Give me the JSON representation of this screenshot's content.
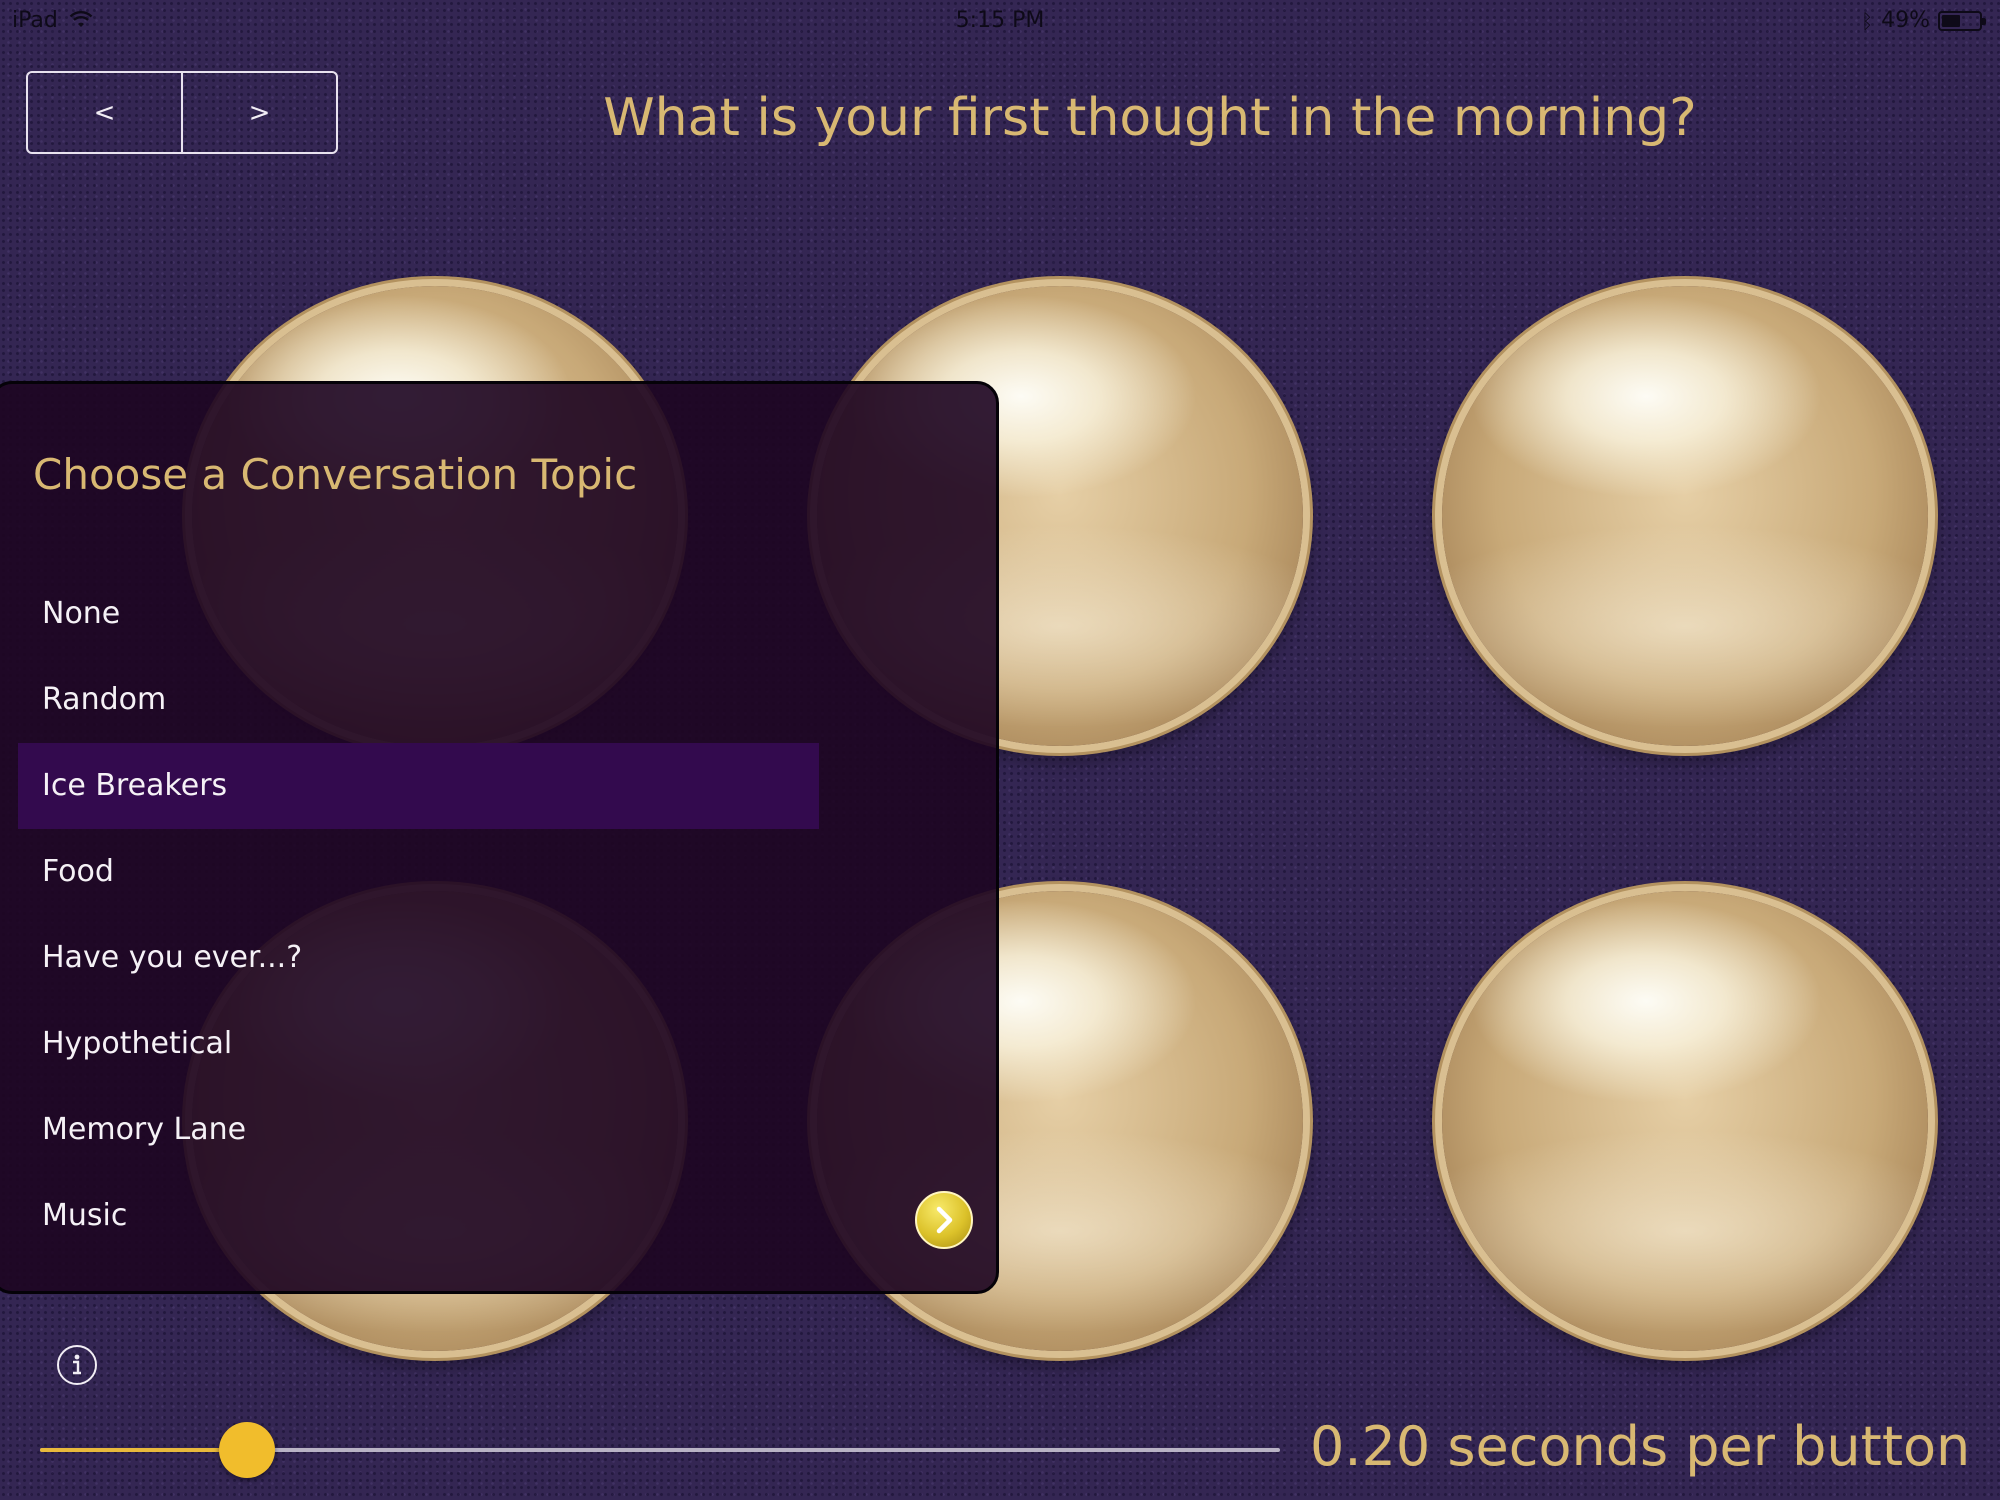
{
  "status_bar": {
    "device": "iPad",
    "time": "5:15 PM",
    "battery_text": "49%",
    "battery_level": 0.49
  },
  "nav": {
    "prev_label": "<",
    "next_label": ">"
  },
  "question": "What is your first thought in the morning?",
  "orbs_count": 6,
  "topic_panel": {
    "title": "Choose a Conversation Topic",
    "topics": [
      "None",
      "Random",
      "Ice Breakers",
      "Food",
      "Have you ever...?",
      "Hypothetical",
      "Memory Lane",
      "Music"
    ],
    "selected_index": 2
  },
  "slider": {
    "value": 0.2,
    "min": 0,
    "max": 1.2
  },
  "speed_label": "0.20 seconds per button",
  "colors": {
    "gold_text": "#d8b872",
    "selection": "#330a4e",
    "slider_accent": "#f1bd2c",
    "background": "#342653"
  }
}
